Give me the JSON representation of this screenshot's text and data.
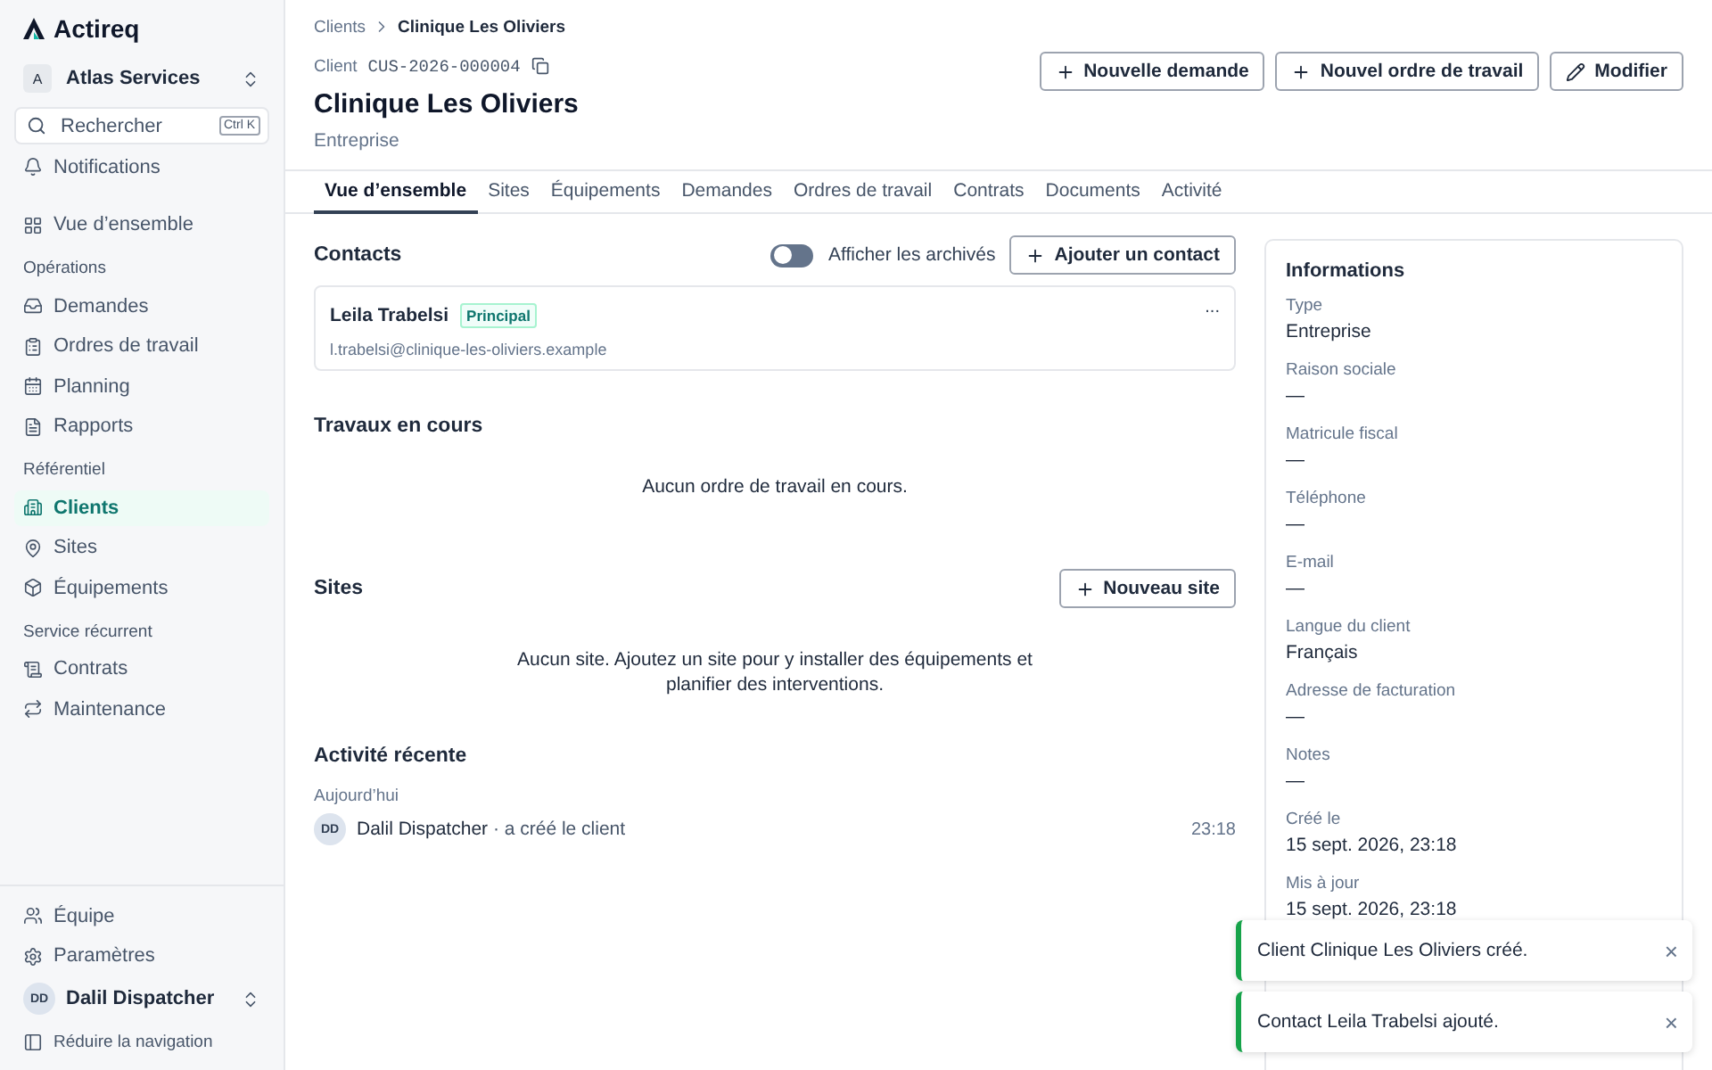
{
  "brand": "Actireq",
  "workspace": {
    "initial": "A",
    "name": "Atlas Services"
  },
  "search": {
    "placeholder": "Rechercher",
    "shortcut": "Ctrl K"
  },
  "nav": [
    {
      "kind": "item",
      "label": "Notifications",
      "selected": false
    },
    {
      "kind": "gap"
    },
    {
      "kind": "item",
      "label": "Vue d’ensemble",
      "selected": false
    },
    {
      "kind": "section",
      "label": "Opérations"
    },
    {
      "kind": "item",
      "label": "Demandes",
      "selected": false
    },
    {
      "kind": "item",
      "label": "Ordres de travail",
      "selected": false
    },
    {
      "kind": "item",
      "label": "Planning",
      "selected": false
    },
    {
      "kind": "item",
      "label": "Rapports",
      "selected": false
    },
    {
      "kind": "section",
      "label": "Référentiel"
    },
    {
      "kind": "item",
      "label": "Clients",
      "selected": true
    },
    {
      "kind": "item",
      "label": "Sites",
      "selected": false
    },
    {
      "kind": "item",
      "label": "Équipements",
      "selected": false
    },
    {
      "kind": "section",
      "label": "Service récurrent"
    },
    {
      "kind": "item",
      "label": "Contrats",
      "selected": false
    },
    {
      "kind": "item",
      "label": "Maintenance",
      "selected": false
    }
  ],
  "footer_nav": [
    {
      "label": "Équipe"
    },
    {
      "label": "Paramètres"
    }
  ],
  "user": {
    "initials": "DD",
    "name": "Dalil Dispatcher"
  },
  "collapse": "Réduire la navigation",
  "breadcrumb": [
    "Clients",
    "Clinique Les Oliviers"
  ],
  "record": {
    "label": "Client",
    "code": "CUS-2026-000004",
    "title": "Clinique Les Oliviers",
    "subtitle": "Entreprise"
  },
  "actions": [
    {
      "kind": "add",
      "label": "Nouvelle demande"
    },
    {
      "kind": "add",
      "label": "Nouvel ordre de travail"
    },
    {
      "kind": "edit",
      "label": "Modifier"
    }
  ],
  "tabs": [
    {
      "label": "Vue d’ensemble",
      "selected": true
    },
    {
      "label": "Sites",
      "selected": false
    },
    {
      "label": "Équipements",
      "selected": false
    },
    {
      "label": "Demandes",
      "selected": false
    },
    {
      "label": "Ordres de travail",
      "selected": false
    },
    {
      "label": "Contrats",
      "selected": false
    },
    {
      "label": "Documents",
      "selected": false
    },
    {
      "label": "Activité",
      "selected": false
    }
  ],
  "contacts": {
    "title": "Contacts",
    "archive_toggle": {
      "label": "Afficher les archivés",
      "on": false
    },
    "add": "Ajouter un contact",
    "items": [
      {
        "name": "Leila Trabelsi",
        "badge": "Principal",
        "email": "l.trabelsi@clinique-les-oliviers.example",
        "menu": "..."
      }
    ]
  },
  "work": {
    "title": "Travaux en cours",
    "empty": "Aucun ordre de travail en cours."
  },
  "sites": {
    "title": "Sites",
    "add": "Nouveau site",
    "empty": "Aucun site. Ajoutez un site pour y installer des équipements et planifier des interventions."
  },
  "activity": {
    "title": "Activité récente",
    "day": "Aujourd’hui",
    "items": [
      {
        "initials": "DD",
        "actor": "Dalil Dispatcher",
        "action": "· a créé le client",
        "time": "23:18"
      }
    ]
  },
  "info": {
    "title": "Informations",
    "fields": [
      {
        "label": "Type",
        "value": "Entreprise"
      },
      {
        "label": "Raison sociale",
        "value": "—"
      },
      {
        "label": "Matricule fiscal",
        "value": "—"
      },
      {
        "label": "Téléphone",
        "value": "—"
      },
      {
        "label": "E-mail",
        "value": "—"
      },
      {
        "label": "Langue du client",
        "value": "Français"
      },
      {
        "label": "Adresse de facturation",
        "value": "—"
      },
      {
        "label": "Notes",
        "value": "—"
      },
      {
        "label": "Créé le",
        "value": "15 sept. 2026, 23:18"
      },
      {
        "label": "Mis à jour",
        "value": "15 sept. 2026, 23:18"
      }
    ]
  },
  "toasts": [
    {
      "message": "Client Clinique Les Oliviers créé.",
      "close": "×"
    },
    {
      "message": "Contact Leila Trabelsi ajouté.",
      "close": "×"
    }
  ]
}
